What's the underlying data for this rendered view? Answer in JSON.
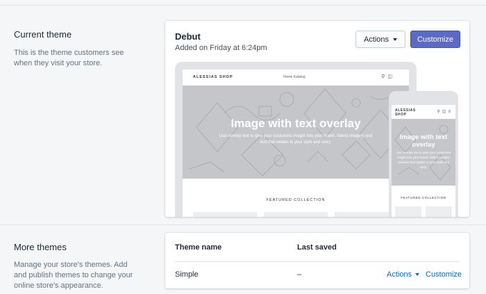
{
  "current_theme": {
    "section_title": "Current theme",
    "section_desc": "This is the theme customers see when they visit your store.",
    "theme_name": "Debut",
    "theme_added": "Added on Friday at 6:24pm",
    "actions_label": "Actions",
    "customize_label": "Customize",
    "preview": {
      "shop_name": "ALESSIAS SHOP",
      "nav": "Home   Katalog",
      "hero_title": "Image with text overlay",
      "hero_text": "Use overlay text to give your customers insight into your brand. Select imagery and text that relates to your style and story.",
      "featured": "FEATURED COLLECTION",
      "mobile_shop_name": "ALESSIAS SHOP",
      "mobile_hero_title": "Image with text overlay",
      "mobile_hero_text": "Use overlay text to give your customers insight into your brand. Select imagery and text that relates to your style and story.",
      "mobile_featured": "FEATURED COLLECTION"
    }
  },
  "more_themes": {
    "section_title": "More themes",
    "section_desc": "Manage your store's themes. Add and publish themes to change your online store's appearance.",
    "columns": [
      "Theme name",
      "Last saved"
    ],
    "rows": [
      {
        "name": "Simple",
        "last_saved": "–",
        "actions_label": "Actions",
        "customize_label": "Customize"
      }
    ]
  },
  "colors": {
    "accent": "#5c6ac4",
    "link": "#006fbb",
    "background": "#f4f6f8"
  },
  "icons": [
    "search-icon",
    "cart-icon",
    "menu-icon",
    "chevron-down-icon"
  ]
}
